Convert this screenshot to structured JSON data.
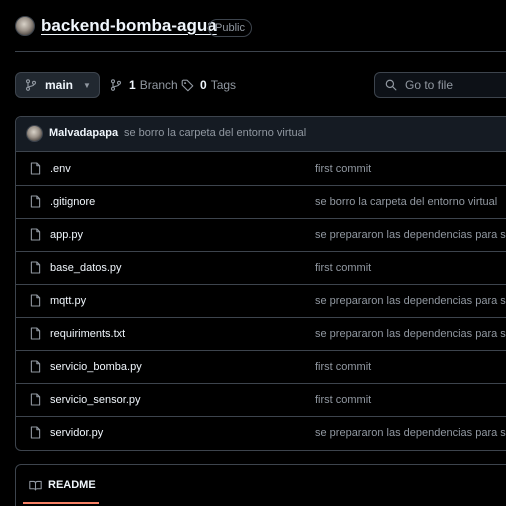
{
  "repo": {
    "name": "backend-bomba-agua",
    "visibility": "Public"
  },
  "toolbar": {
    "branch_name": "main",
    "branch_count": "1",
    "branch_label": "Branch",
    "tags_count": "0",
    "tags_label": "Tags",
    "search_placeholder": "Go to file"
  },
  "latest_commit": {
    "author": "Malvadapapa",
    "message": "se borro la carpeta del entorno virtual"
  },
  "files": [
    {
      "name": ".env",
      "commit": "first commit"
    },
    {
      "name": ".gitignore",
      "commit": "se borro la carpeta del entorno virtual"
    },
    {
      "name": "app.py",
      "commit": "se prepararon las dependencias para su"
    },
    {
      "name": "base_datos.py",
      "commit": "first commit"
    },
    {
      "name": "mqtt.py",
      "commit": "se prepararon las dependencias para su"
    },
    {
      "name": "requiriments.txt",
      "commit": "se prepararon las dependencias para su"
    },
    {
      "name": "servicio_bomba.py",
      "commit": "first commit"
    },
    {
      "name": "servicio_sensor.py",
      "commit": "first commit"
    },
    {
      "name": "servidor.py",
      "commit": "se prepararon las dependencias para su"
    }
  ],
  "readme": {
    "tab_label": "README"
  },
  "colors": {
    "background": "#000000",
    "border": "#3d444d",
    "text": "#f0f6fc",
    "muted": "#9198a1",
    "accent": "#f78166"
  },
  "icons": [
    "repo-avatar",
    "git-branch-icon",
    "tag-icon",
    "file-icon",
    "book-icon"
  ]
}
